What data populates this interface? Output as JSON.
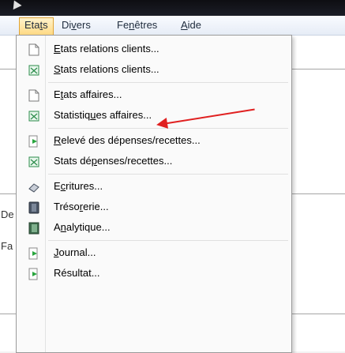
{
  "menubar": {
    "items": [
      {
        "label": "Etats",
        "mnemonic_index": 3
      },
      {
        "label": "Divers",
        "mnemonic_index": 2
      },
      {
        "label": "Fenêtres",
        "mnemonic_index": 2
      },
      {
        "label": "Aide",
        "mnemonic_index": 0
      }
    ]
  },
  "background": {
    "text_1": "De",
    "text_2": "Fa"
  },
  "menu": {
    "items": [
      {
        "label": "Etats relations clients...",
        "icon": "document-icon",
        "u": 0
      },
      {
        "label": "Stats relations clients...",
        "icon": "spreadsheet-icon",
        "u": 0
      },
      {
        "label": "Etats affaires...",
        "icon": "document-icon",
        "u": 1
      },
      {
        "label": "Statistiques affaires...",
        "icon": "spreadsheet-icon",
        "u": 9
      },
      {
        "label": "Relevé des dépenses/recettes...",
        "icon": "export-icon",
        "u": 0
      },
      {
        "label": "Stats dépenses/recettes...",
        "icon": "spreadsheet-icon",
        "u": 8
      },
      {
        "label": "Ecritures...",
        "icon": "eraser-icon",
        "u": 1
      },
      {
        "label": "Trésorerie...",
        "icon": "safe-icon",
        "u": 5
      },
      {
        "label": "Analytique...",
        "icon": "chart-book-icon",
        "u": 1
      },
      {
        "label": "Journal...",
        "icon": "export-icon",
        "u": 0
      },
      {
        "label": "Résultat...",
        "icon": "export-icon",
        "u": -1
      }
    ]
  },
  "colors": {
    "accent_arrow": "#e02020",
    "menu_highlight": "#ffd880"
  }
}
